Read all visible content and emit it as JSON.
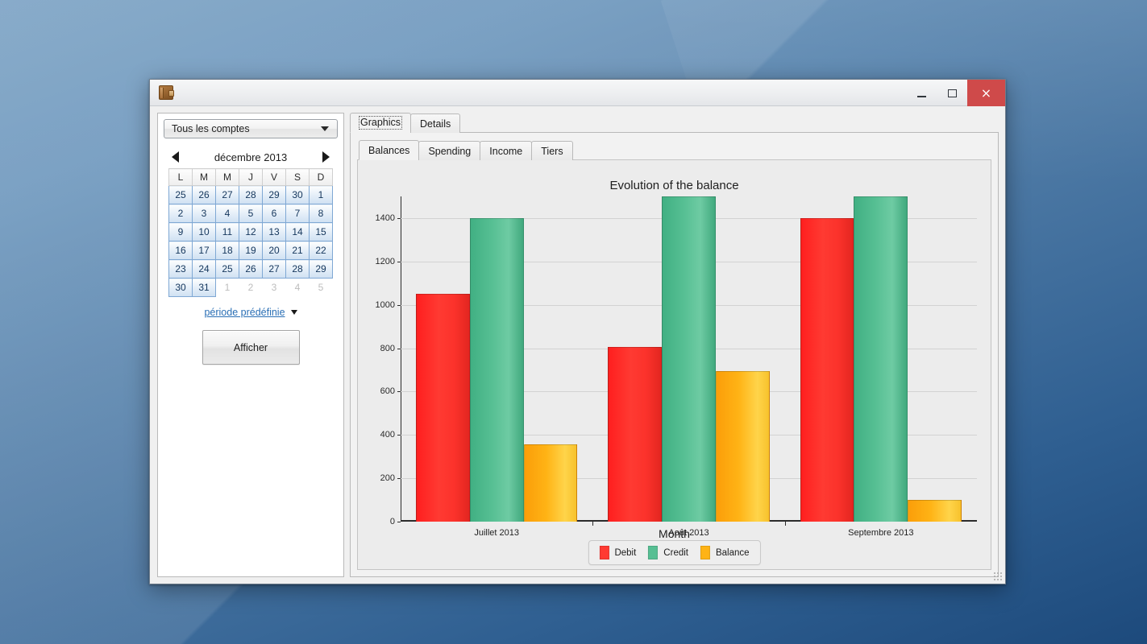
{
  "window": {
    "app_icon": "wallet-icon",
    "controls": {
      "minimize": "–",
      "maximize": "□",
      "close": "×"
    }
  },
  "sidebar": {
    "account_select": {
      "value": "Tous les comptes",
      "caret": "chevron-down-icon"
    },
    "calendar": {
      "prev_arrow": "left-arrow-icon",
      "next_arrow": "right-arrow-icon",
      "month_label": "décembre 2013",
      "weekdays": [
        "L",
        "M",
        "M",
        "J",
        "V",
        "S",
        "D"
      ],
      "weeks": [
        [
          {
            "d": "25",
            "dim": false
          },
          {
            "d": "26",
            "dim": false
          },
          {
            "d": "27",
            "dim": false
          },
          {
            "d": "28",
            "dim": false
          },
          {
            "d": "29",
            "dim": false
          },
          {
            "d": "30",
            "dim": false
          },
          {
            "d": "1",
            "dim": false
          }
        ],
        [
          {
            "d": "2",
            "dim": false
          },
          {
            "d": "3",
            "dim": false
          },
          {
            "d": "4",
            "dim": false
          },
          {
            "d": "5",
            "dim": false
          },
          {
            "d": "6",
            "dim": false
          },
          {
            "d": "7",
            "dim": false
          },
          {
            "d": "8",
            "dim": false
          }
        ],
        [
          {
            "d": "9",
            "dim": false
          },
          {
            "d": "10",
            "dim": false
          },
          {
            "d": "11",
            "dim": false
          },
          {
            "d": "12",
            "dim": false
          },
          {
            "d": "13",
            "dim": false
          },
          {
            "d": "14",
            "dim": false
          },
          {
            "d": "15",
            "dim": false
          }
        ],
        [
          {
            "d": "16",
            "dim": false
          },
          {
            "d": "17",
            "dim": false
          },
          {
            "d": "18",
            "dim": false
          },
          {
            "d": "19",
            "dim": false
          },
          {
            "d": "20",
            "dim": false
          },
          {
            "d": "21",
            "dim": false
          },
          {
            "d": "22",
            "dim": false
          }
        ],
        [
          {
            "d": "23",
            "dim": false
          },
          {
            "d": "24",
            "dim": false
          },
          {
            "d": "25",
            "dim": false
          },
          {
            "d": "26",
            "dim": false
          },
          {
            "d": "27",
            "dim": false
          },
          {
            "d": "28",
            "dim": false
          },
          {
            "d": "29",
            "dim": false
          }
        ],
        [
          {
            "d": "30",
            "dim": false
          },
          {
            "d": "31",
            "dim": false
          },
          {
            "d": "1",
            "dim": true
          },
          {
            "d": "2",
            "dim": true
          },
          {
            "d": "3",
            "dim": true
          },
          {
            "d": "4",
            "dim": true
          },
          {
            "d": "5",
            "dim": true
          }
        ]
      ]
    },
    "predefined_period": {
      "label": "période prédéfinie",
      "caret": "chevron-down-icon"
    },
    "show_button": "Afficher"
  },
  "main": {
    "outer_tabs": [
      {
        "label": "Graphics",
        "active": true
      },
      {
        "label": "Details",
        "active": false
      }
    ],
    "inner_tabs": [
      {
        "label": "Balances",
        "active": true
      },
      {
        "label": "Spending",
        "active": false
      },
      {
        "label": "Income",
        "active": false
      },
      {
        "label": "Tiers",
        "active": false
      }
    ]
  },
  "colors": {
    "debit": "#ff3a32",
    "credit": "#56bf93",
    "balance": "#ffb315",
    "close_button": "#cf4a4a",
    "link": "#2a6fb5"
  },
  "chart_data": {
    "type": "bar",
    "title": "Evolution of the balance",
    "xlabel": "Month",
    "ylabel": "",
    "categories": [
      "Juillet 2013",
      "Août 2013",
      "Septembre 2013"
    ],
    "yticks": [
      0,
      200,
      400,
      600,
      800,
      1000,
      1200,
      1400
    ],
    "ylim": [
      0,
      1500
    ],
    "grid": true,
    "legend_position": "bottom",
    "series": [
      {
        "name": "Debit",
        "color": "#ff3a32",
        "values": [
          1050,
          805,
          1400
        ]
      },
      {
        "name": "Credit",
        "color": "#56bf93",
        "values": [
          1400,
          1500,
          1500
        ]
      },
      {
        "name": "Balance",
        "color": "#ffb315",
        "values": [
          355,
          695,
          100
        ]
      }
    ]
  }
}
